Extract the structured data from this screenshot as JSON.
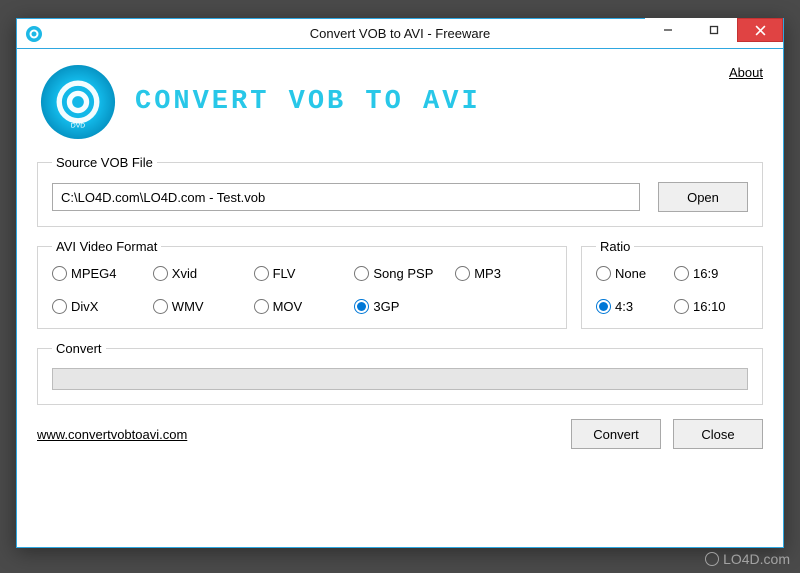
{
  "window": {
    "title": "Convert VOB to AVI - Freeware"
  },
  "header": {
    "app_title": "Convert VOB to AVI",
    "about_label": "About"
  },
  "source": {
    "legend": "Source VOB File",
    "value": "C:\\LO4D.com\\LO4D.com - Test.vob",
    "open_label": "Open"
  },
  "format": {
    "legend": "AVI Video Format",
    "options": [
      {
        "label": "MPEG4"
      },
      {
        "label": "Xvid"
      },
      {
        "label": "FLV"
      },
      {
        "label": "Song PSP"
      },
      {
        "label": "MP3"
      },
      {
        "label": "DivX"
      },
      {
        "label": "WMV"
      },
      {
        "label": "MOV"
      },
      {
        "label": "3GP"
      }
    ],
    "selected": "3GP"
  },
  "ratio": {
    "legend": "Ratio",
    "options": [
      {
        "label": "None"
      },
      {
        "label": "16:9"
      },
      {
        "label": "4:3"
      },
      {
        "label": "16:10"
      }
    ],
    "selected": "4:3"
  },
  "convert": {
    "legend": "Convert"
  },
  "footer": {
    "site_url": "www.convertvobtoavi.com",
    "convert_label": "Convert",
    "close_label": "Close"
  },
  "watermark": {
    "text": "LO4D.com"
  }
}
